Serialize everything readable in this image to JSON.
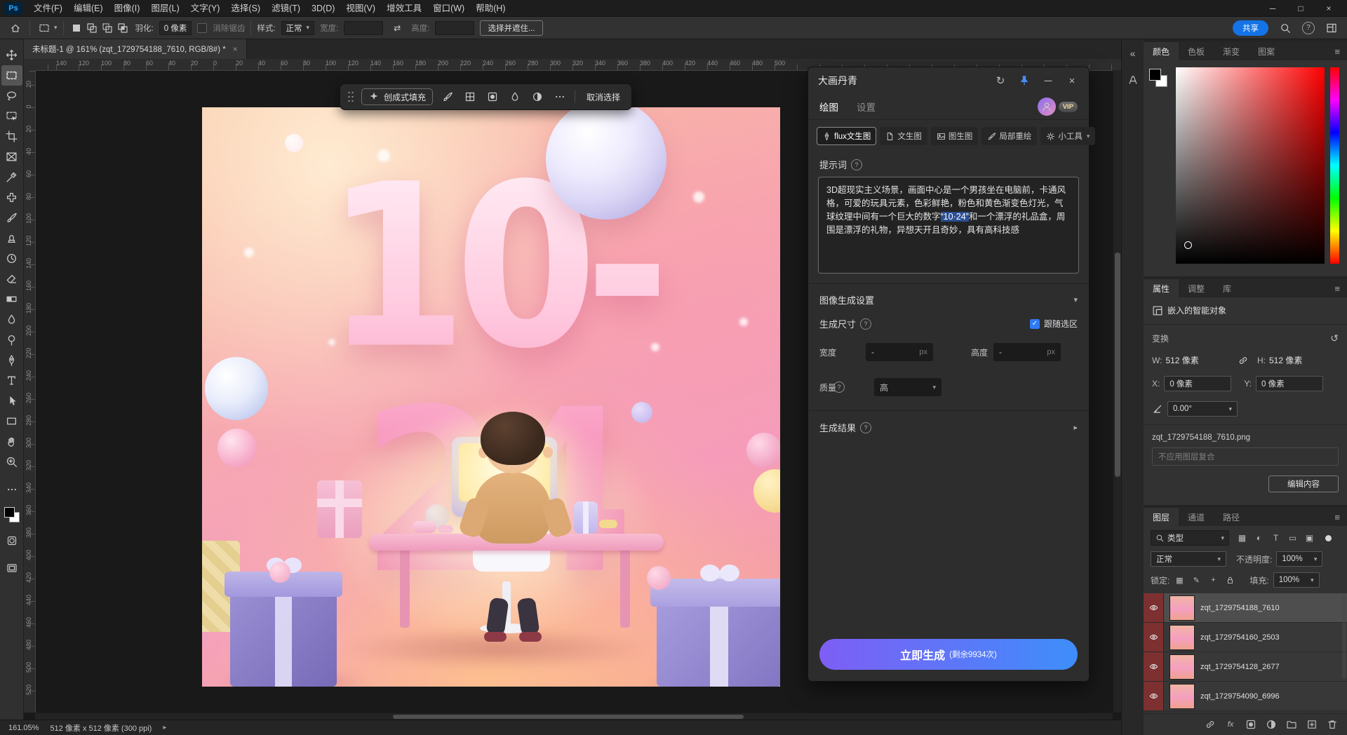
{
  "app": {
    "logo_text": "Ps",
    "menus": [
      "文件(F)",
      "编辑(E)",
      "图像(I)",
      "图层(L)",
      "文字(Y)",
      "选择(S)",
      "滤镜(T)",
      "3D(D)",
      "视图(V)",
      "增效工具",
      "窗口(W)",
      "帮助(H)"
    ]
  },
  "window_controls": {
    "minimize": "─",
    "maximize": "□",
    "close": "×"
  },
  "glyphs": {
    "chevron_down": "▾",
    "chevron_right": "▸",
    "menu": "≡",
    "refresh": "↻",
    "reset": "↺",
    "collapse": "«",
    "swap": "⇄",
    "check": "✓",
    "question": "?",
    "fx": "fx",
    "tab_close": "×",
    "minimize": "─"
  },
  "options": {
    "feather_label": "羽化:",
    "feather_value": "0 像素",
    "antialias_label": "消除锯齿",
    "style_label": "样式:",
    "style_value": "正常",
    "width_label": "宽度:",
    "height_label": "高度:",
    "select_mask_button": "选择并遮住...",
    "share_button": "共享"
  },
  "document_tab": "未标题-1 @ 161% (zqt_1729754188_7610, RGB/8#) *",
  "tools": [
    "move",
    "rect-marquee",
    "lasso",
    "object-selection",
    "crop",
    "frame",
    "eyedropper",
    "spot-healing",
    "brush",
    "clone-stamp",
    "history-brush",
    "eraser",
    "gradient",
    "blur",
    "dodge",
    "pen",
    "type",
    "path-selection",
    "rectangle",
    "hand",
    "zoom"
  ],
  "rulers": {
    "horizontal": [
      "140",
      "120",
      "100",
      "80",
      "60",
      "40",
      "20",
      "0",
      "20",
      "40",
      "60",
      "80",
      "100",
      "120",
      "140",
      "160",
      "180",
      "200",
      "220",
      "240",
      "260",
      "280",
      "300",
      "320",
      "340",
      "360",
      "380",
      "400",
      "420",
      "440",
      "460",
      "480",
      "500"
    ],
    "vertical": [
      "20",
      "0",
      "20",
      "40",
      "60",
      "80",
      "100",
      "120",
      "140",
      "160",
      "180",
      "200",
      "220",
      "240",
      "260",
      "280",
      "300",
      "320",
      "340",
      "360",
      "380",
      "400",
      "420",
      "440",
      "460",
      "480",
      "500",
      "520"
    ]
  },
  "taskbar": {
    "generative_fill": "创成式填充",
    "deselect": "取消选择"
  },
  "canvas_art": {
    "headline": "10-24"
  },
  "plugin": {
    "title": "大画丹青",
    "tab_draw": "绘图",
    "tab_settings": "设置",
    "vip": "VIP",
    "modes": [
      "flux文生图",
      "文生图",
      "图生图",
      "局部重绘",
      "小工具"
    ],
    "prompt_label": "提示词",
    "prompt_before": "3D超现实主义场景，画面中心是一个男孩坐在电脑前，卡通风格，可爱的玩具元素，色彩鲜艳，粉色和黄色渐变色灯光，气球纹理中间有一个巨大的数字",
    "prompt_selected": "“10·24”",
    "prompt_after": "和一个漂浮的礼品盒，周围是漂浮的礼物，异想天开且奇妙，具有高科技感",
    "settings_header": "图像生成设置",
    "size_label": "生成尺寸",
    "follow_selection": "跟随选区",
    "width_label": "宽度",
    "width_value": "-",
    "height_label": "高度",
    "height_value": "-",
    "px_suffix": "px",
    "quality_label": "质量",
    "quality_value": "高",
    "results_header": "生成结果",
    "generate_label": "立即生成",
    "generate_remaining": "(剩余9934次)"
  },
  "color_panel": {
    "tabs": [
      "颜色",
      "色板",
      "渐变",
      "图案"
    ]
  },
  "properties_panel": {
    "tabs": [
      "属性",
      "调整",
      "库"
    ],
    "object_type": "嵌入的智能对象",
    "transform_label": "变换",
    "w_label": "W:",
    "w_value": "512 像素",
    "h_label": "H:",
    "h_value": "512 像素",
    "x_label": "X:",
    "x_value": "0 像素",
    "y_label": "Y:",
    "y_value": "0 像素",
    "angle_value": "0.00°",
    "filename": "zqt_1729754188_7610.png",
    "layer_comp": "不应用图层复合",
    "edit_content": "编辑内容"
  },
  "layers_panel": {
    "tabs": [
      "图层",
      "通道",
      "路径"
    ],
    "filter_label": "类型",
    "filter_icons": [
      "▦",
      "◐",
      "T",
      "▭",
      "▣"
    ],
    "blend_mode": "正常",
    "opacity_label": "不透明度:",
    "opacity_value": "100%",
    "lock_label": "锁定:",
    "lock_icons": [
      "▦",
      "✎",
      "+"
    ],
    "fill_label": "填充:",
    "fill_value": "100%",
    "layers": [
      "zqt_1729754188_7610",
      "zqt_1729754160_2503",
      "zqt_1729754128_2677",
      "zqt_1729754090_6996"
    ]
  },
  "statusbar": {
    "zoom": "161.05%",
    "doc_info": "512 像素 x 512 像素 (300 ppi)"
  },
  "colors": {
    "ps_blue": "#1473e6",
    "pin_blue": "#4a8df8",
    "generate_gradient_start": "#7e5ef5",
    "generate_gradient_end": "#3e8efb",
    "checkbox_blue": "#2f7bf6",
    "layer_label_red": "#7d3030",
    "prompt_selection": "#2b4f94"
  }
}
